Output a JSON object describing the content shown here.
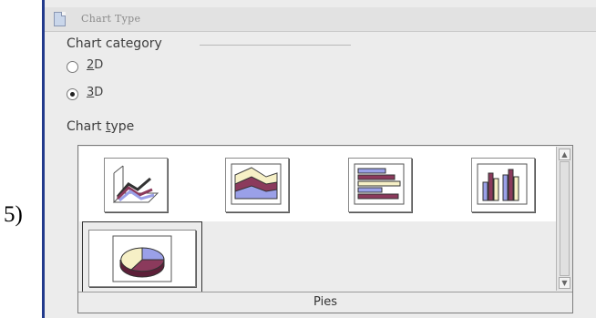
{
  "step_label": "5)",
  "dialog": {
    "title": "Chart Type",
    "title_icon": "document-icon",
    "category": {
      "label": "Chart category",
      "options": [
        {
          "prefix": "",
          "accel": "2",
          "rest": "D",
          "selected": false
        },
        {
          "prefix": "",
          "accel": "3",
          "rest": "D",
          "selected": true
        }
      ]
    },
    "chart_type": {
      "label_prefix": "Chart ",
      "label_accel": "t",
      "label_rest": "ype",
      "icons": [
        "3d-lines-chart-icon",
        "3d-area-chart-icon",
        "3d-bar-chart-icon",
        "3d-column-chart-icon",
        "3d-pie-chart-icon"
      ],
      "selected_name": "Pies"
    }
  }
}
